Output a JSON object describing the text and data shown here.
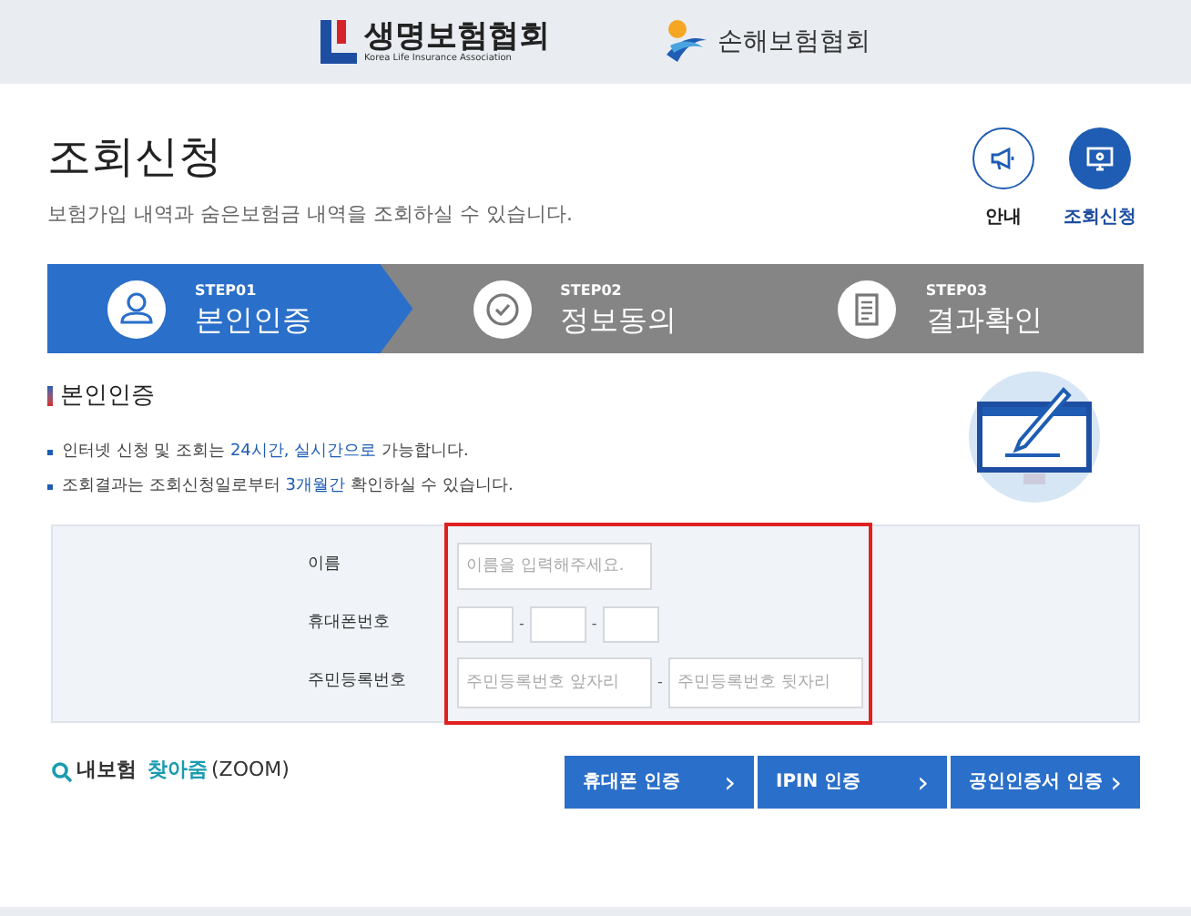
{
  "header": {
    "logos": [
      {
        "kind": "life",
        "name": "생명보험협회",
        "subtitle": "Korea Life Insurance Association"
      },
      {
        "kind": "nonlife",
        "name": "손해보험협회"
      }
    ]
  },
  "page": {
    "title": "조회신청",
    "description": "보험가입 내역과 숨은보험금 내역을 조회하실 수 있습니다."
  },
  "quick_links": [
    {
      "kind": "megaphone",
      "label": "안내",
      "selected": false
    },
    {
      "kind": "monitor",
      "label": "조회신청",
      "selected": true
    }
  ],
  "steps": [
    {
      "kind": "user",
      "step": "STEP01",
      "label": "본인인증",
      "selected": true
    },
    {
      "kind": "check",
      "step": "STEP02",
      "label": "정보동의",
      "selected": false
    },
    {
      "kind": "document",
      "step": "STEP03",
      "label": "결과확인",
      "selected": false
    }
  ],
  "section": {
    "title": "본인인증",
    "notes": [
      "인터넷 신청 및 조회는 **24시간, 실시간으로** 가능합니다.",
      "조회결과는 조회신청일로부터 **3개월간** 확인하실 수 있습니다."
    ]
  },
  "form": {
    "rows": [
      {
        "kind": "name",
        "label": "이름",
        "fields": [
          {
            "placeholder": "이름을 입력해주세요."
          }
        ]
      },
      {
        "kind": "phone",
        "label": "휴대폰번호",
        "separator": "-",
        "fields": [
          {
            "empty": true
          },
          {
            "empty": true
          },
          {
            "empty": true
          }
        ]
      },
      {
        "kind": "rrn",
        "label": "주민등록번호",
        "separator": "-",
        "fields": [
          {
            "placeholder": "주민등록번호 앞자리"
          },
          {
            "placeholder": "주민등록번호 뒷자리"
          }
        ]
      }
    ]
  },
  "zoom_link": {
    "prefix": "내보험",
    "highlight": "찾아줌",
    "suffix": "(ZOOM)"
  },
  "buttons": [
    {
      "label": "휴대폰 인증",
      "arrow": "›"
    },
    {
      "label": "IPIN 인증",
      "arrow": "›"
    },
    {
      "label": "공인인증서 인증",
      "arrow": "›"
    }
  ]
}
